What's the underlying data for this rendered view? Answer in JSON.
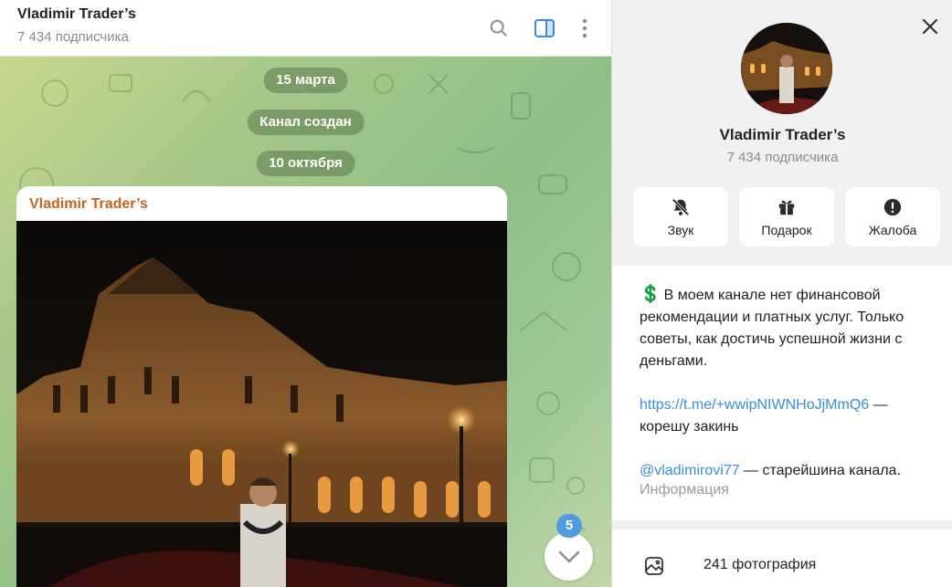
{
  "header": {
    "title": "Vladimir Trader’s",
    "subscribers": "7 434 подписчика"
  },
  "chat": {
    "dates": [
      "15 марта",
      "Канал создан",
      "10 октября"
    ],
    "message": {
      "author": "Vladimir Trader’s"
    },
    "unread_count": "5"
  },
  "panel": {
    "name": "Vladimir Trader’s",
    "subscribers": "7 434 подписчика",
    "actions": [
      {
        "label": "Звук",
        "icon": "bell-off-icon"
      },
      {
        "label": "Подарок",
        "icon": "gift-icon"
      },
      {
        "label": "Жалоба",
        "icon": "alert-circle-icon"
      }
    ],
    "description": {
      "emoji": "💲",
      "text": "В моем канале нет финансовой рекомендации и платных услуг. Только советы, как достичь успешной жизни с деньгами.",
      "link": "https://t.me/+wwipNIWNHoJjMmQ6",
      "link_suffix": " — корешу закинь",
      "mention": "@vladimirovi77",
      "mention_suffix": " — старейшина канала.",
      "label": "Информация"
    },
    "media": {
      "label": "241 фотография",
      "icon": "photo-icon"
    }
  },
  "colors": {
    "accent": "#3a8dd6",
    "author": "#c2661f",
    "badge": "#4f9dde"
  }
}
